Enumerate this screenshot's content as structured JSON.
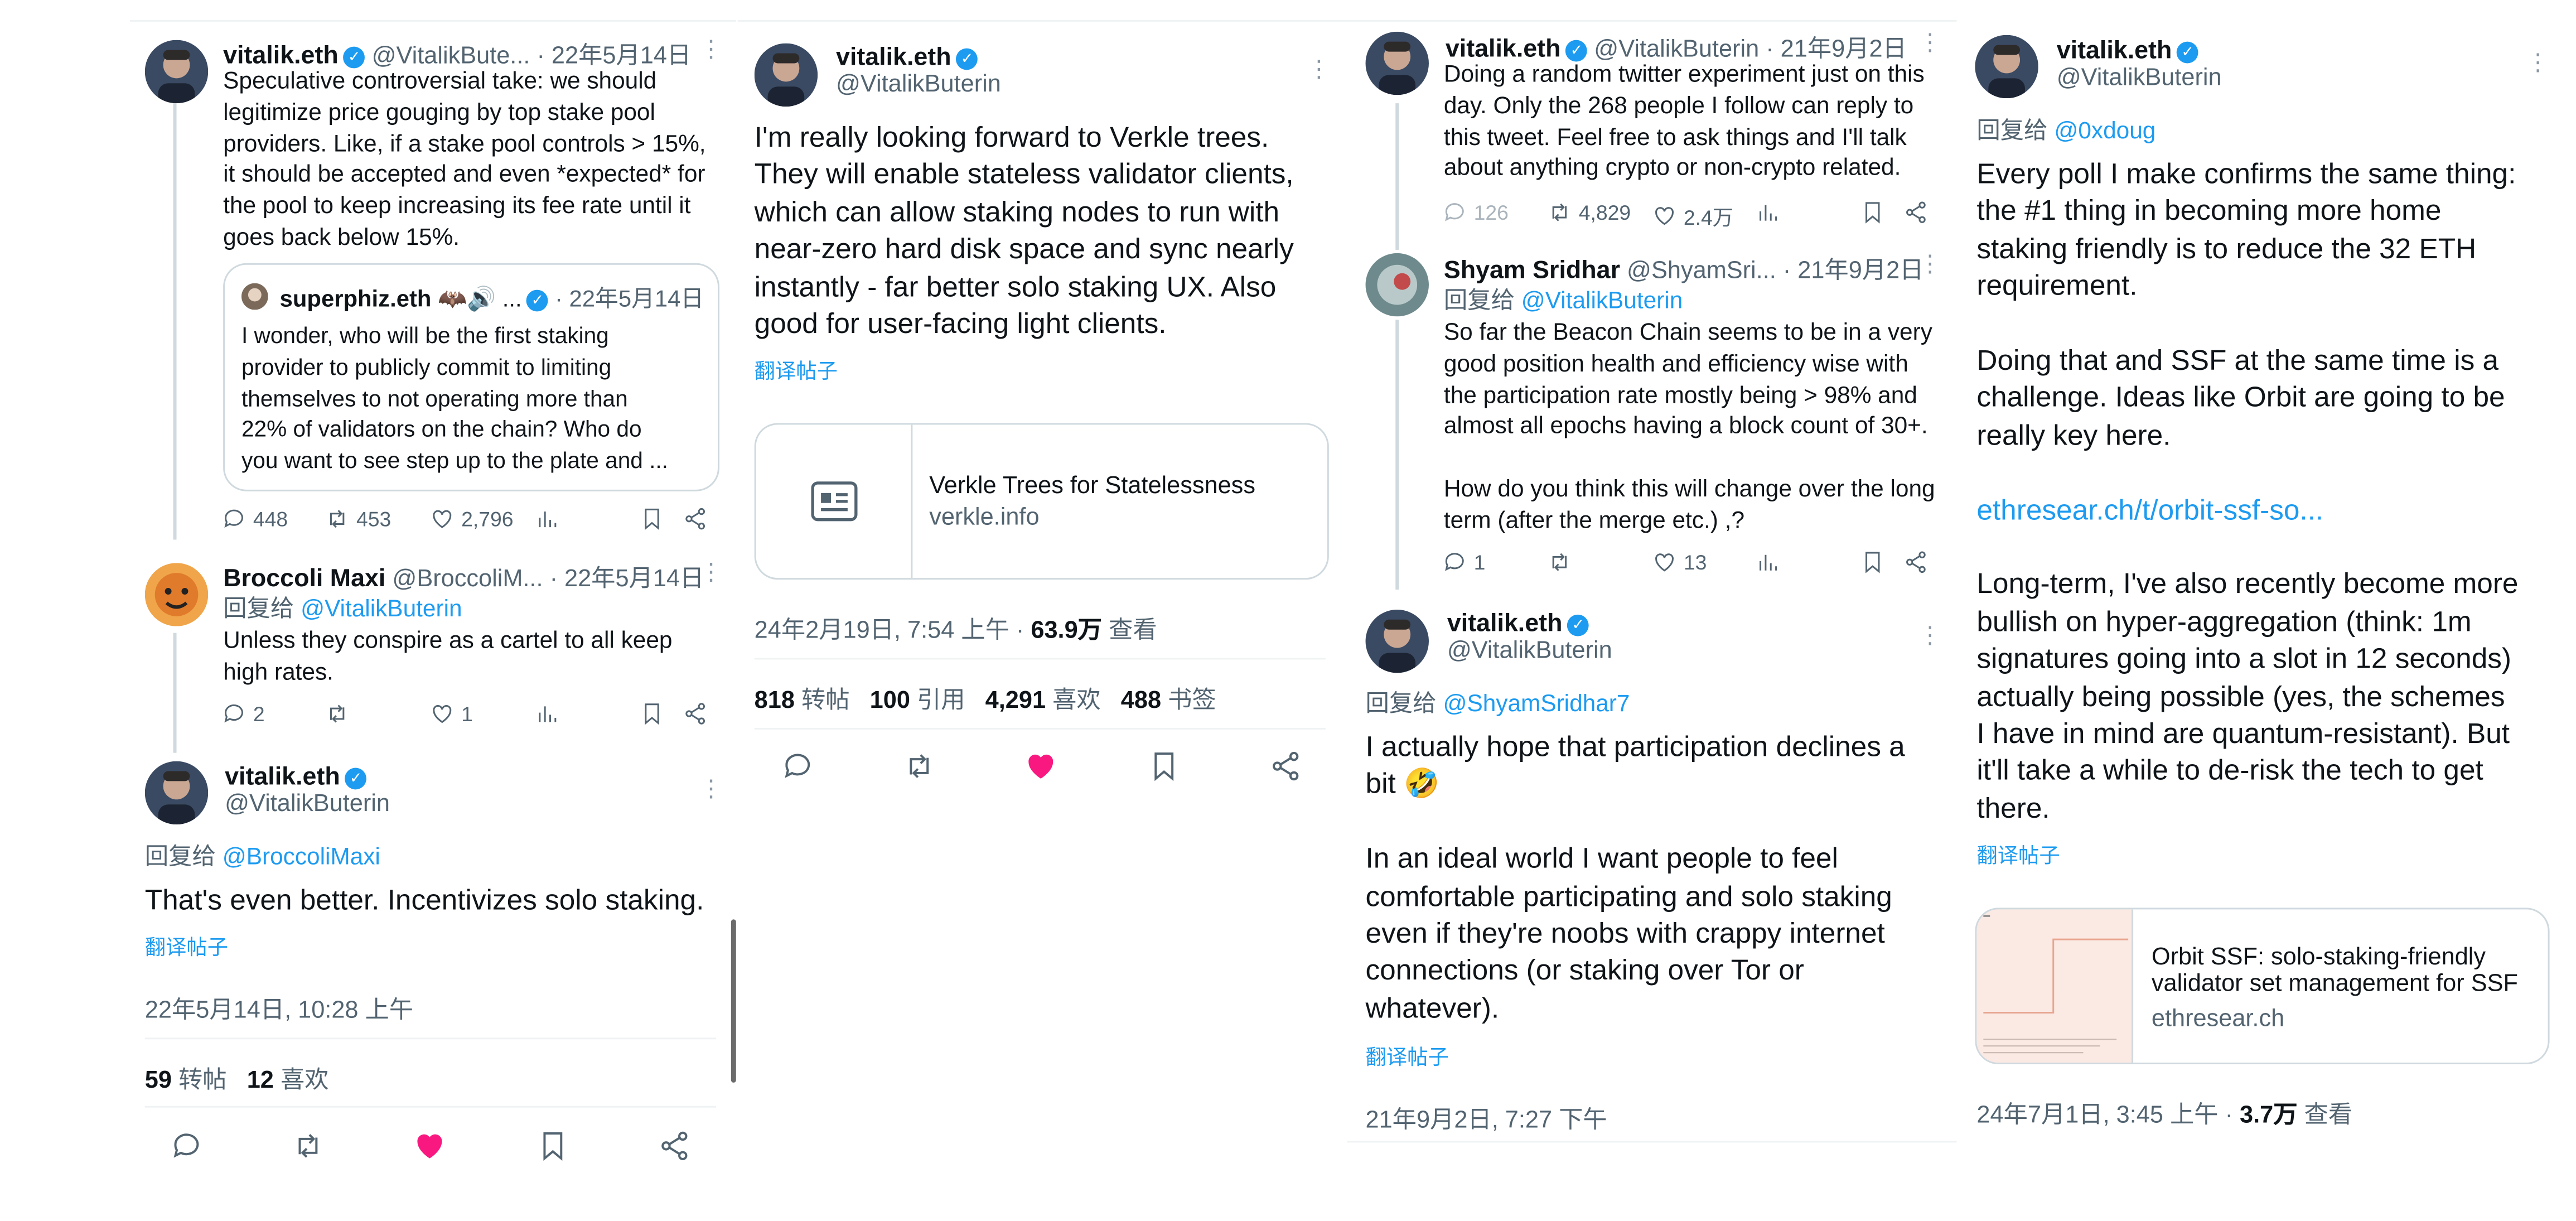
{
  "colors": {
    "accent": "#1d9bf0",
    "like": "#f91880",
    "text": "#0f1419",
    "muted": "#536471",
    "border": "#cfd9de"
  },
  "col1": {
    "t1": {
      "name": "vitalik.eth",
      "handle": "@VitalikBute...",
      "date": "· 22年5月14日",
      "lines": [
        "Speculative controversial take: we should",
        "legitimize price gouging by top stake pool",
        "providers. Like, if a stake pool controls > 15%,",
        "it should be accepted and even *expected* for",
        "the pool to keep increasing its fee rate until it",
        "goes back below 15%."
      ],
      "quote": {
        "name": "superphiz.eth",
        "emoji": "🦇🔊 ...",
        "date": "· 22年5月14日",
        "lines": [
          "I wonder, who will be the first staking",
          "provider to publicly commit to limiting",
          "themselves to not operating more than",
          "22% of validators on the chain? Who do",
          "you want to see step up to the plate and ..."
        ]
      },
      "replies": "448",
      "retweets": "453",
      "likes": "2,796"
    },
    "t2": {
      "name": "Broccoli Maxi",
      "handle": "@BroccoliM...",
      "date": "· 22年5月14日",
      "reply_prefix": "回复给",
      "reply_to": "@VitalikButerin",
      "lines": [
        "Unless they conspire as a cartel to all keep",
        "high rates."
      ],
      "replies": "2",
      "likes": "1"
    },
    "t3": {
      "name": "vitalik.eth",
      "handle": "@VitalikButerin",
      "reply_prefix": "回复给",
      "reply_to": "@BroccoliMaxi",
      "text": "That's even better. Incentivizes solo staking.",
      "translate": "翻译帖子",
      "timestamp": "22年5月14日, 10:28 上午",
      "retweets_n": "59",
      "retweets_l": "转帖",
      "likes_n": "12",
      "likes_l": "喜欢"
    }
  },
  "col2": {
    "name": "vitalik.eth",
    "handle": "@VitalikButerin",
    "lines": [
      "I'm really looking forward to Verkle trees.",
      "They will enable stateless validator clients,",
      "which can allow staking nodes to run with",
      "near-zero hard disk space and sync nearly",
      "instantly - far better solo staking UX. Also",
      "good for user-facing light clients."
    ],
    "translate": "翻译帖子",
    "card_title": "Verkle Trees for Statelessness",
    "card_domain": "verkle.info",
    "timestamp": "24年2月19日, 7:54 上午 · ",
    "views_n": "63.9万",
    "views_l": "查看",
    "stats": [
      {
        "n": "818",
        "l": "转帖"
      },
      {
        "n": "100",
        "l": "引用"
      },
      {
        "n": "4,291",
        "l": "喜欢"
      },
      {
        "n": "488",
        "l": "书签"
      }
    ]
  },
  "col3": {
    "t1": {
      "name": "vitalik.eth",
      "handle": "@VitalikButerin",
      "date": "· 21年9月2日",
      "lines": [
        "Doing a random twitter experiment just on this",
        "day. Only the 268 people I follow can reply to",
        "this tweet. Feel free to ask things and I'll talk",
        "about anything crypto or non-crypto related."
      ],
      "replies": "126",
      "retweets": "4,829",
      "likes": "2.4万"
    },
    "t2": {
      "name": "Shyam Sridhar",
      "handle": "@ShyamSri...",
      "date": "· 21年9月2日",
      "reply_prefix": "回复给",
      "reply_to": "@VitalikButerin",
      "lines": [
        "So far the Beacon Chain seems to be in a very",
        "good position health and efficiency wise with",
        "the participation rate mostly being > 98% and",
        "almost all epochs having a block count of 30+.",
        "",
        "How do you think this will change over the long",
        "term (after the merge etc.) ,?"
      ],
      "replies": "1",
      "likes": "13"
    },
    "t3": {
      "name": "vitalik.eth",
      "handle": "@VitalikButerin",
      "reply_prefix": "回复给",
      "reply_to": "@ShyamSridhar7",
      "lines": [
        "I actually hope that participation declines a",
        "bit 🤣",
        "",
        "In an ideal world I want people to feel",
        "comfortable participating and solo staking",
        "even if they're noobs with crappy internet",
        "connections (or staking over Tor or",
        "whatever)."
      ],
      "translate": "翻译帖子",
      "timestamp": "21年9月2日, 7:27 下午"
    }
  },
  "col4": {
    "name": "vitalik.eth",
    "handle": "@VitalikButerin",
    "reply_prefix": "回复给",
    "reply_to": "@0xdoug",
    "lines": [
      "Every poll I make confirms the same thing:",
      "the #1 thing in becoming more home",
      "staking friendly is to reduce the 32 ETH",
      "requirement.",
      "",
      "Doing that and SSF at the same time is a",
      "challenge. Ideas like Orbit are going to be",
      "really key here.",
      "",
      "ethresear.ch/t/orbit-ssf-so...",
      "",
      "Long-term, I've also recently become more",
      "bullish on hyper-aggregation (think: 1m",
      "signatures going into a slot in 12 seconds)",
      "actually being possible (yes, the schemes",
      "I have in mind are quantum-resistant). But",
      "it'll take a while to de-risk the tech to get",
      "there."
    ],
    "translate": "翻译帖子",
    "card_title_1": "Orbit SSF: solo-staking-friendly",
    "card_title_2": "validator set management for SSF",
    "card_domain": "ethresear.ch",
    "timestamp": "24年7月1日, 3:45 上午 · ",
    "views_n": "3.7万",
    "views_l": "查看"
  }
}
